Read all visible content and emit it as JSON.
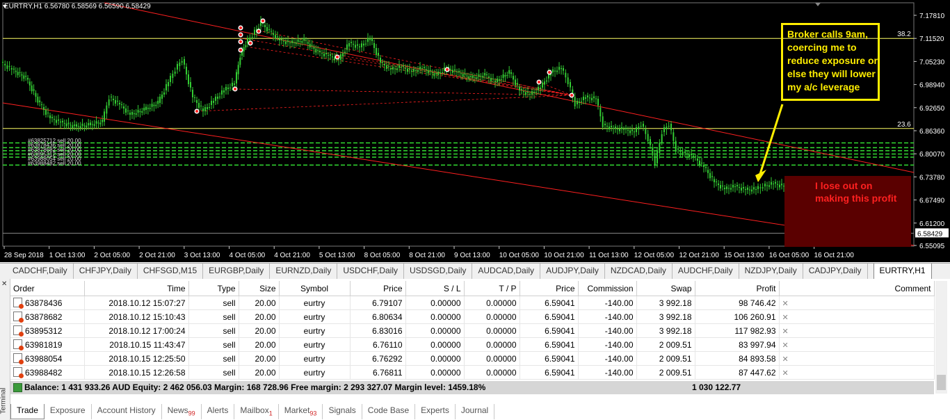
{
  "chart": {
    "header": "EURTRY,H1  6.56780 6.58569 6.56590 6.58429",
    "price_labels": [
      "7.17810",
      "7.11520",
      "7.05230",
      "6.98940",
      "6.92650",
      "6.86360",
      "6.80070",
      "6.73780",
      "6.67490",
      "6.61200",
      "6.55095"
    ],
    "current_price": "6.58429",
    "fib_label_1": "38.2",
    "fib_label_2": "23.6",
    "time_labels": [
      "28 Sep 2018",
      "1 Oct 13:00",
      "2 Oct 05:00",
      "2 Oct 21:00",
      "3 Oct 13:00",
      "4 Oct 05:00",
      "4 Oct 21:00",
      "5 Oct 13:00",
      "8 Oct 05:00",
      "8 Oct 21:00",
      "9 Oct 13:00",
      "10 Oct 05:00",
      "10 Oct 21:00",
      "11 Oct 13:00",
      "12 Oct 05:00",
      "12 Oct 21:00",
      "15 Oct 13:00",
      "16 Oct 05:00",
      "16 Oct 21:00"
    ],
    "order_labels": [
      "#63825712 sell 20.00",
      "#63878436 sell 20.00",
      "#63878682 sell 20.00",
      "#63895312 sell 20.00",
      "#63988054 sell 20.00",
      "#63988482 sell 20.00"
    ],
    "annotation_broker": "Broker calls 9am,\ncoercing me to\nreduce exposure or\nelse they will lower\nmy a/c leverage",
    "annotation_profit": "I lose out on\nmaking this profit",
    "colors": {
      "candle": "#33cc33",
      "trendline": "#ff2020",
      "fib": "#ffff66",
      "annot_yellow": "#ffee00",
      "annot_red": "#ff2020"
    }
  },
  "symbol_tabs": [
    "CADCHF,Daily",
    "CHFJPY,Daily",
    "CHFSGD,M15",
    "EURGBP,Daily",
    "EURNZD,Daily",
    "USDCHF,Daily",
    "USDSGD,Daily",
    "AUDCAD,Daily",
    "AUDJPY,Daily",
    "NZDCAD,Daily",
    "AUDCHF,Daily",
    "NZDJPY,Daily",
    "CADJPY,Daily",
    "EURTRY,H1"
  ],
  "terminal": {
    "side_label": "Terminal",
    "columns": [
      "Order",
      "Time",
      "Type",
      "Size",
      "Symbol",
      "Price",
      "S / L",
      "T / P",
      "Price",
      "Commission",
      "Swap",
      "Profit",
      "Comment"
    ],
    "rows": [
      [
        "63878436",
        "2018.10.12 15:07:27",
        "sell",
        "20.00",
        "eurtry",
        "6.79107",
        "0.00000",
        "0.00000",
        "6.59041",
        "-140.00",
        "3 992.18",
        "98 746.42"
      ],
      [
        "63878682",
        "2018.10.12 15:10:43",
        "sell",
        "20.00",
        "eurtry",
        "6.80634",
        "0.00000",
        "0.00000",
        "6.59041",
        "-140.00",
        "3 992.18",
        "106 260.91"
      ],
      [
        "63895312",
        "2018.10.12 17:00:24",
        "sell",
        "20.00",
        "eurtry",
        "6.83016",
        "0.00000",
        "0.00000",
        "6.59041",
        "-140.00",
        "3 992.18",
        "117 982.93"
      ],
      [
        "63981819",
        "2018.10.15 11:43:47",
        "sell",
        "20.00",
        "eurtry",
        "6.76110",
        "0.00000",
        "0.00000",
        "6.59041",
        "-140.00",
        "2 009.51",
        "83 997.94"
      ],
      [
        "63988054",
        "2018.10.15 12:25:50",
        "sell",
        "20.00",
        "eurtry",
        "6.76292",
        "0.00000",
        "0.00000",
        "6.59041",
        "-140.00",
        "2 009.51",
        "84 893.58"
      ],
      [
        "63988482",
        "2018.10.15 12:26:58",
        "sell",
        "20.00",
        "eurtry",
        "6.76811",
        "0.00000",
        "0.00000",
        "6.59041",
        "-140.00",
        "2 009.51",
        "87 447.62"
      ]
    ],
    "balance_line": "Balance: 1 431 933.26 AUD  Equity: 2 462 056.03  Margin: 168 728.96  Free margin: 2 293 327.07  Margin level: 1459.18%",
    "total_profit": "1 030 122.77",
    "tabs": [
      {
        "label": "Trade",
        "badge": ""
      },
      {
        "label": "Exposure",
        "badge": ""
      },
      {
        "label": "Account History",
        "badge": ""
      },
      {
        "label": "News",
        "badge": "99"
      },
      {
        "label": "Alerts",
        "badge": ""
      },
      {
        "label": "Mailbox",
        "badge": "1"
      },
      {
        "label": "Market",
        "badge": "93"
      },
      {
        "label": "Signals",
        "badge": ""
      },
      {
        "label": "Code Base",
        "badge": ""
      },
      {
        "label": "Experts",
        "badge": ""
      },
      {
        "label": "Journal",
        "badge": ""
      }
    ]
  }
}
